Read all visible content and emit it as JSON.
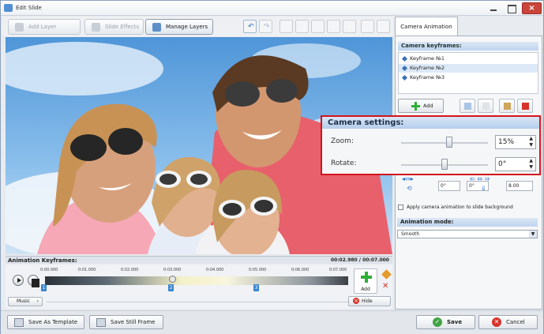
{
  "window": {
    "title": "Edit Slide"
  },
  "toolbar": {
    "add_layer": "Add Layer",
    "slide_effects": "Slide Effects",
    "manage_layers": "Manage Layers"
  },
  "timeline": {
    "title": "Animation Keyframes:",
    "time": "00:02.980 / 00:07.000",
    "ticks": [
      "0:00.000",
      "0:01.000",
      "0:02.000",
      "0:03.000",
      "0:04.000",
      "0:05.000",
      "0:06.000",
      "0:07.000"
    ],
    "markers": [
      "1",
      "2",
      "3"
    ],
    "add_label": "Add",
    "music_label": "Music",
    "hide_label": "Hide"
  },
  "bottom": {
    "save_template": "Save As Template",
    "save_still": "Save Still Frame",
    "save": "Save",
    "cancel": "Cancel"
  },
  "right_panel": {
    "tab": "Camera Animation",
    "keyframes_header": "Camera keyframes:",
    "keyframes": [
      "Keyframe №1",
      "Keyframe №2",
      "Keyframe №3"
    ],
    "selected_keyframe": 1,
    "add_label": "Add",
    "camera_settings_header": "Camera settings:",
    "zoom_label": "Zoom:",
    "zoom_value": "15%",
    "rotate_label": "Rotate:",
    "rotate_value": "0°",
    "pan_x_value": "0°",
    "pan_value_2": "0°",
    "duration_value": "8.00",
    "apply_bg_label": "Apply camera animation to slide background",
    "mode_header": "Animation mode:",
    "mode_value": "Smooth"
  }
}
